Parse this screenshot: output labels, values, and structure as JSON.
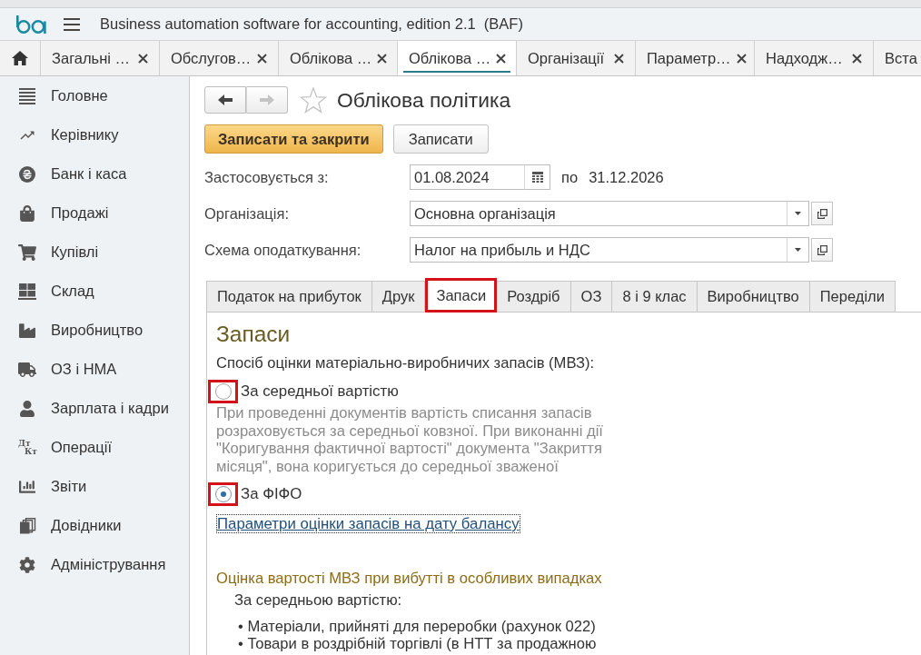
{
  "window": {
    "title": "Business automation software for accounting, edition 2.1  (BAF)"
  },
  "open_tabs": [
    {
      "label": "Загальні …",
      "selected": false,
      "closable": true
    },
    {
      "label": "Обслугов…",
      "selected": false,
      "closable": true
    },
    {
      "label": "Облікова …",
      "selected": false,
      "closable": true
    },
    {
      "label": "Облікова …",
      "selected": true,
      "closable": true
    },
    {
      "label": "Організації",
      "selected": false,
      "closable": true
    },
    {
      "label": "Параметр…",
      "selected": false,
      "closable": true
    },
    {
      "label": "Надходж…",
      "selected": false,
      "closable": true
    },
    {
      "label": "Вста",
      "selected": false,
      "closable": false
    }
  ],
  "sidebar": {
    "items": [
      {
        "label": "Головне"
      },
      {
        "label": "Керівнику"
      },
      {
        "label": "Банк і каса"
      },
      {
        "label": "Продажі"
      },
      {
        "label": "Купівлі"
      },
      {
        "label": "Склад"
      },
      {
        "label": "Виробництво"
      },
      {
        "label": "ОЗ і НМА"
      },
      {
        "label": "Зарплата і кадри"
      },
      {
        "label": "Операції",
        "icon_text": [
          "Дт",
          "Кт"
        ]
      },
      {
        "label": "Звіти"
      },
      {
        "label": "Довідники"
      },
      {
        "label": "Адміністрування"
      }
    ]
  },
  "document": {
    "title": "Облікова політика",
    "favorite": false,
    "back_disabled": false,
    "forward_disabled": true
  },
  "actions": [
    {
      "label": "Записати та закрити",
      "kind": "primary"
    },
    {
      "label": "Записати",
      "kind": "secondary"
    }
  ],
  "fields": [
    {
      "kind": "date_range",
      "label": "Застосовується з:",
      "value": "01.08.2024",
      "separator": "по",
      "end": "31.12.2026"
    },
    {
      "kind": "select",
      "label": "Організація:",
      "value": "Основна організація"
    },
    {
      "kind": "select",
      "label": "Схема оподаткування:",
      "value": "Налог на прибыль и НДС"
    }
  ],
  "form_tabs": [
    {
      "label": "Податок на прибуток",
      "selected": false,
      "highlighted": false
    },
    {
      "label": "Друк",
      "selected": false,
      "highlighted": false
    },
    {
      "label": "Запаси",
      "selected": true,
      "highlighted": true
    },
    {
      "label": "Роздріб",
      "selected": false,
      "highlighted": false
    },
    {
      "label": "ОЗ",
      "selected": false,
      "highlighted": false
    },
    {
      "label": "8 і 9 клас",
      "selected": false,
      "highlighted": false
    },
    {
      "label": "Виробництво",
      "selected": false,
      "highlighted": false
    },
    {
      "label": "Переділи",
      "selected": false,
      "highlighted": false
    }
  ],
  "section": {
    "heading": "Запаси",
    "prompt": "Спосіб оцінки матеріально-виробничих запасів (МВЗ):",
    "options": [
      {
        "label": "За середньої вартістю",
        "selected": false,
        "highlighted": true,
        "description": "При проведенні документів вартість списання запасів розраховується за середньої ковзної. При виконанні дії \"Коригування фактичної вартості\" документа \"Закриття місяця\", вона коригується до середньої зваженої"
      },
      {
        "label": "За ФІФО",
        "selected": true,
        "highlighted": true
      }
    ],
    "link": {
      "label": "Параметри оцінки запасів на дату балансу",
      "focused": true
    },
    "subheading": "Оцінка вартості МВЗ при вибутті в особливих випадках",
    "group_label": "За середньою вартістю:",
    "bullets": [
      "• Матеріали, прийняті для переробки (рахунок 022)",
      "• Товари в роздрібній торгівлі (в НТТ за продажною"
    ]
  }
}
